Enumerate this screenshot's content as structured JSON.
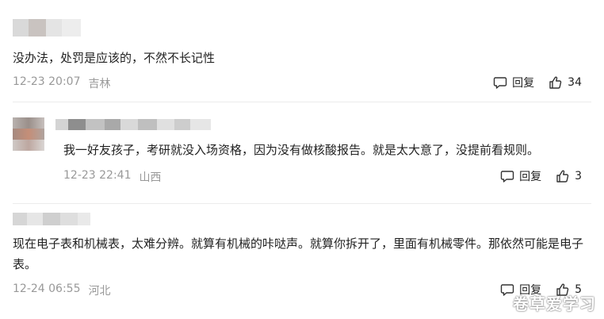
{
  "comments": [
    {
      "text": "没办法，处罚是应该的，不然不长记性",
      "date": "12-23 20:07",
      "location": "吉林",
      "reply_label": "回复",
      "like_count": "34"
    },
    {
      "text": "我一好友孩子，考研就没入场资格，因为没有做核酸报告。就是太大意了，没提前看规则。",
      "date": "12-23 22:41",
      "location": "山西",
      "reply_label": "回复",
      "like_count": "3"
    },
    {
      "text": "现在电子表和机械表，太难分辨。就算有机械的咔哒声。就算你拆开了，里面有机械零件。那依然可能是电子表。",
      "date": "12-24 06:55",
      "location": "河北",
      "reply_label": "回复",
      "like_count": "5"
    }
  ],
  "watermark": "卷草爱学习",
  "icons": {
    "reply": "comment-bubble-icon",
    "like": "thumbs-up-icon"
  },
  "colors": {
    "meta": "#999999",
    "text": "#222222",
    "divider": "#ececec"
  }
}
